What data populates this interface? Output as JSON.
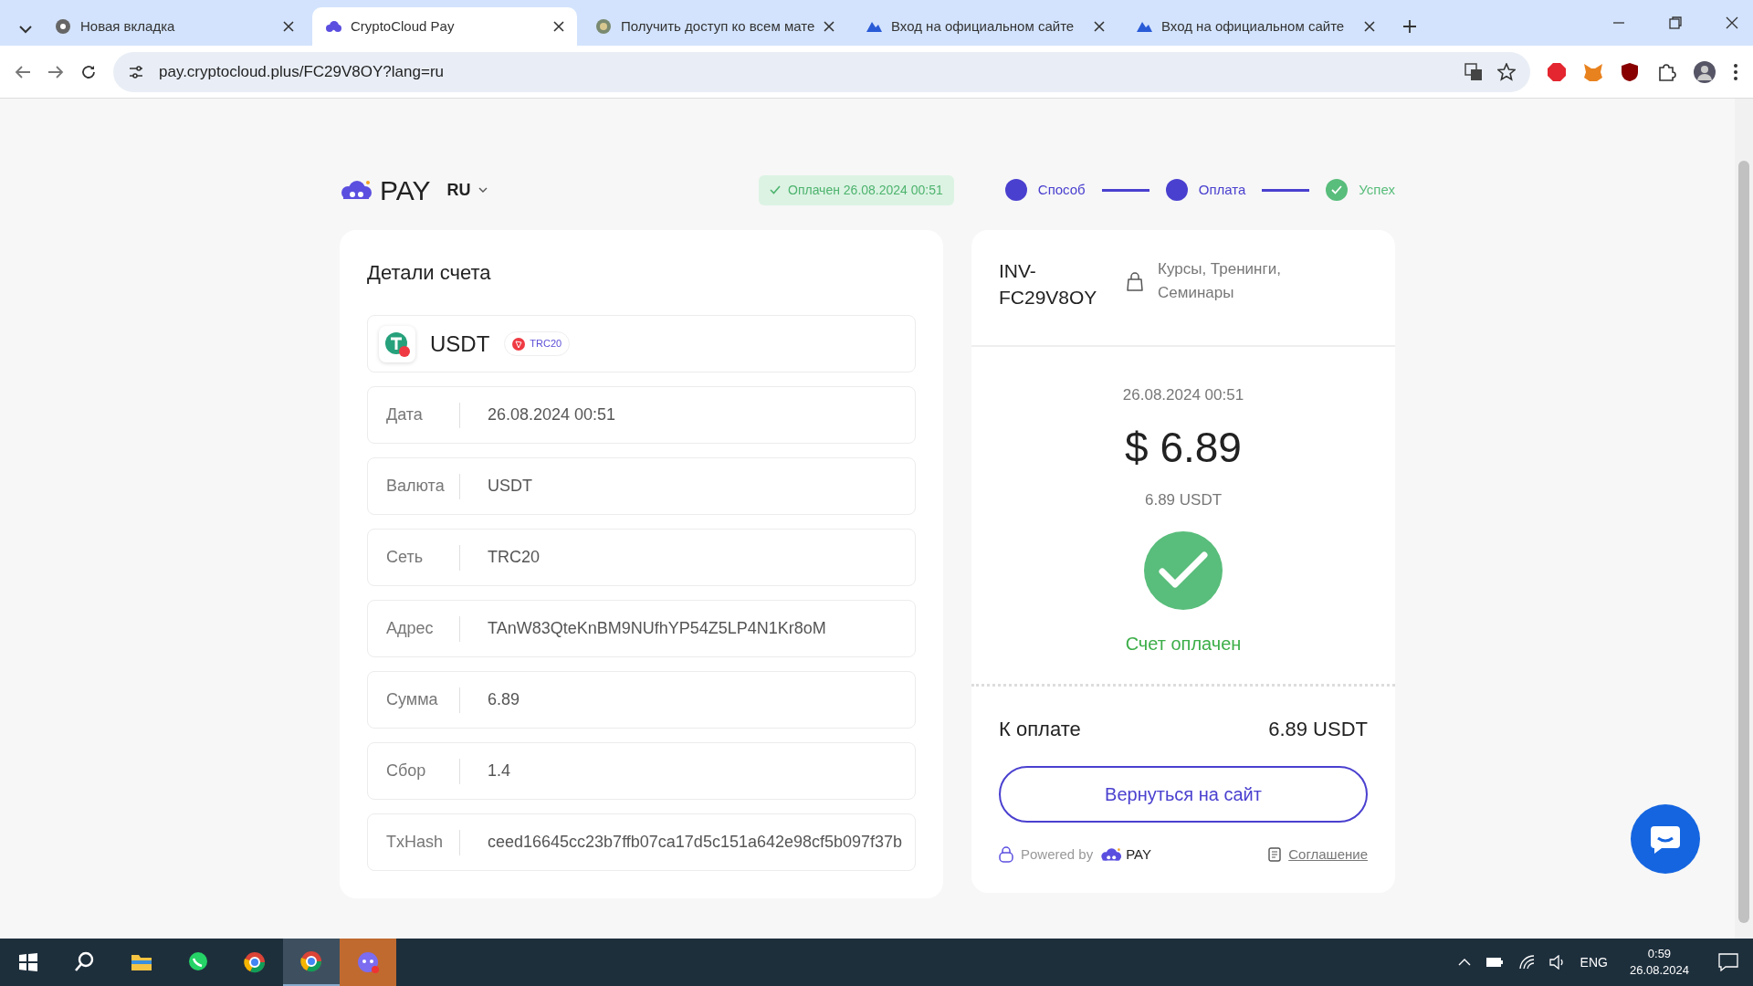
{
  "browser": {
    "tabs": [
      {
        "title": "Новая вкладка",
        "selected": false
      },
      {
        "title": "CryptoCloud Pay",
        "selected": true
      },
      {
        "title": "Получить доступ ко всем мате",
        "selected": false
      },
      {
        "title": "Вход на официальном сайте",
        "selected": false
      },
      {
        "title": "Вход на официальном сайте",
        "selected": false
      }
    ],
    "url": "pay.cryptocloud.plus/FC29V8OY?lang=ru"
  },
  "header": {
    "brand": "PAY",
    "language": "RU",
    "status": "Оплачен 26.08.2024 00:51",
    "steps": [
      {
        "label": "Способ",
        "kind": "done"
      },
      {
        "label": "Оплата",
        "kind": "done"
      },
      {
        "label": "Успех",
        "kind": "success"
      }
    ]
  },
  "details": {
    "title": "Детали счета",
    "currency": {
      "name": "USDT",
      "network": "TRC20"
    },
    "rows": [
      {
        "label": "Дата",
        "value": "26.08.2024 00:51"
      },
      {
        "label": "Валюта",
        "value": "USDT"
      },
      {
        "label": "Сеть",
        "value": "TRC20"
      },
      {
        "label": "Адрес",
        "value": "TAnW83QteKnBM9NUfhYP54Z5LP4N1Kr8oM"
      },
      {
        "label": "Сумма",
        "value": "6.89"
      },
      {
        "label": "Сбор",
        "value": "1.4"
      },
      {
        "label": "TxHash",
        "value": "ceed16645cc23b7ffb07ca17d5c151a642e98cf5b097f37b"
      }
    ]
  },
  "invoice": {
    "id": "INV-FC29V8OY",
    "category": "Курсы, Тренинги, Семинары",
    "date": "26.08.2024 00:51",
    "amount": "$ 6.89",
    "amount_crypto": "6.89 USDT",
    "status": "Счет оплачен",
    "due_label": "К оплате",
    "due_value": "6.89 USDT",
    "button": "Вернуться на сайт",
    "powered_by": "Powered by",
    "powered_brand": "PAY",
    "agreement": "Соглашение"
  },
  "taskbar": {
    "language": "ENG",
    "time": "0:59",
    "date": "26.08.2024"
  }
}
